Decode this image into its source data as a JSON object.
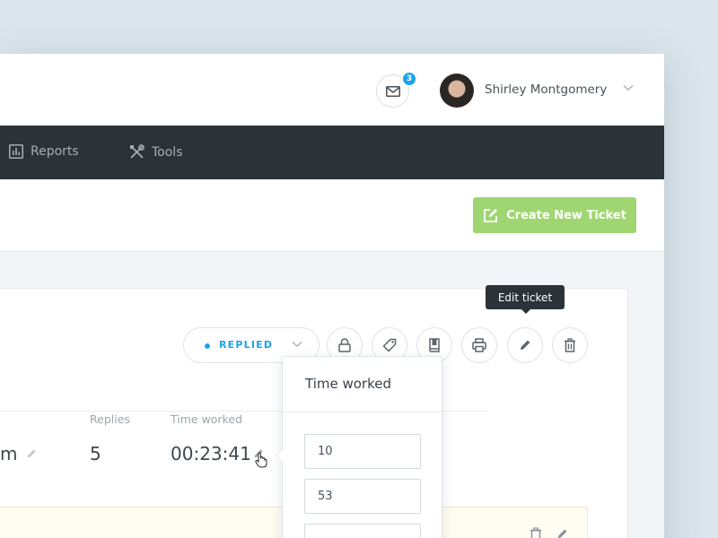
{
  "header": {
    "mail_badge_count": "3",
    "user_name": "Shirley Montgomery"
  },
  "nav": {
    "reports_label": "Reports",
    "tools_label": "Tools"
  },
  "toolbar": {
    "create_ticket_label": "Create New Ticket"
  },
  "ticket": {
    "tooltip": "Edit ticket",
    "status": "REPLIED",
    "stats": {
      "truncated_value": "m",
      "replies_label": "Replies",
      "replies_value": "5",
      "time_worked_label": "Time worked",
      "time_worked_value": "00:23:41"
    }
  },
  "time_popover": {
    "title": "Time worked",
    "hours_value": "10",
    "minutes_value": "53"
  },
  "colors": {
    "accent_blue": "#1fa3ea",
    "create_green": "#9fd672",
    "nav_dark": "#2c3338"
  }
}
